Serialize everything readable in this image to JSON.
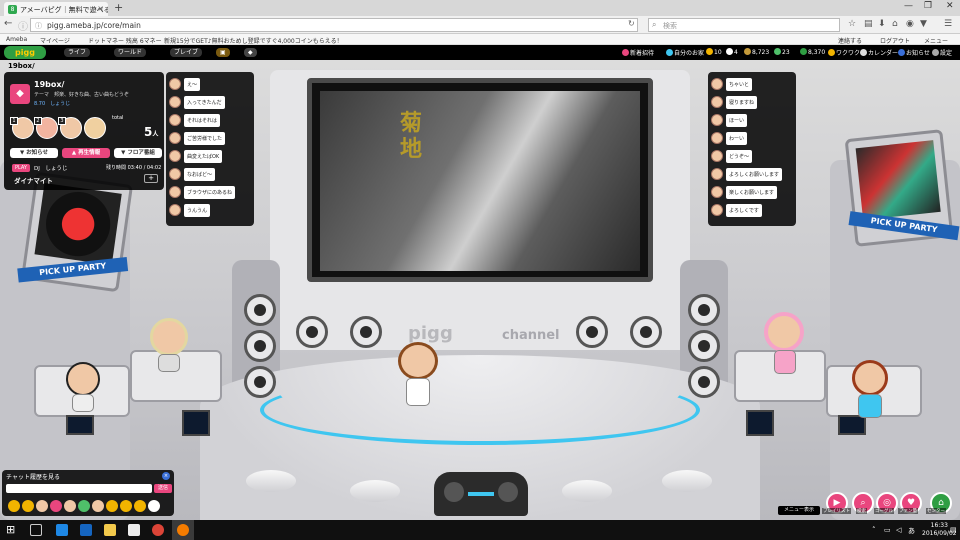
{
  "browser": {
    "tab_title": "アメーバピグ｜無料で遊べる…",
    "tab_close": "×",
    "new_tab": "+",
    "url": "pigg.ameba.jp/core/main",
    "search_placeholder": "検索"
  },
  "bookmarks": [
    {
      "label": "Ameba"
    },
    {
      "label": "マイページ"
    },
    {
      "label": "ドットマネー 残高 6マネー"
    },
    {
      "label": "新規15分でGET♪無料おためし登録ですぐ4,000コインもらえる！"
    },
    {
      "label": "連絡する"
    },
    {
      "label": "ログアウト"
    },
    {
      "label": "メニュー"
    }
  ],
  "ameba_bar": {
    "logo": "pigg",
    "menus": [
      "ライフ",
      "ワールド",
      "ブレイブ"
    ],
    "right_items": [
      {
        "label": "新着招待"
      },
      {
        "label": "自分のお家"
      },
      {
        "label": "10"
      },
      {
        "label": "4"
      },
      {
        "label": "8,723"
      },
      {
        "label": "23"
      },
      {
        "label": "8,370"
      },
      {
        "label": "ワクワク"
      },
      {
        "label": "カレンダー"
      },
      {
        "label": "お知らせ"
      },
      {
        "label": "設定"
      }
    ]
  },
  "room": {
    "breadcrumb": "19box/",
    "name": "19box/",
    "theme": "テーマ　邦楽、好きな曲、古い曲もどうぞ",
    "host": "8.70　しょうじ",
    "total_label": "total",
    "total_count": "5",
    "total_unit": "人",
    "people_numbers": [
      "1",
      "2",
      "3"
    ],
    "buttons": [
      "▼ お知らせ",
      "▲ 再生情報",
      "▼ フロア番組"
    ],
    "play_label": "PLAY",
    "dj": "DJ　しょうじ",
    "play_time": "残り時間 03:40 / 04:02",
    "song": "ダイナマイト",
    "add": "+"
  },
  "stage": {
    "pigg_logo": "pigg",
    "channel_logo": "channel",
    "pickup_left": "PICK UP PARTY",
    "pickup_right": "PICK UP PARTY",
    "video_text": "菊地"
  },
  "chat_left": [
    {
      "text": "え～"
    },
    {
      "text": "入ってきたんだ"
    },
    {
      "text": "それはそれは"
    },
    {
      "text": "ご苦労様でした"
    },
    {
      "text": "曲変えたばOK"
    },
    {
      "text": "なおばど～"
    },
    {
      "text": "ブラウザにのあるね"
    },
    {
      "text": "うんうん"
    }
  ],
  "chat_right": [
    {
      "text": "ちゃいと"
    },
    {
      "text": "寝りますね"
    },
    {
      "text": "ほーい"
    },
    {
      "text": "わーい"
    },
    {
      "text": "どうぞ～"
    },
    {
      "text": "よろしくお願いします"
    },
    {
      "text": "楽しくお願いします"
    },
    {
      "text": "よろしくです"
    }
  ],
  "chat_panel": {
    "label": "チャット履歴を見る",
    "close": "×",
    "send": "送信"
  },
  "right_buttons": [
    {
      "label": "プレイリスト",
      "color": "#e9467e"
    },
    {
      "label": "検索",
      "color": "#e9467e"
    },
    {
      "label": "ゴーグル",
      "color": "#e9467e"
    },
    {
      "label": "ファン量",
      "color": "#e9467e"
    },
    {
      "label": "センター",
      "color": "#2f9e43"
    }
  ],
  "menu_button": "メニュー表示",
  "taskbar": {
    "time": "16:33",
    "date": "2016/09/02",
    "ime": "あ"
  },
  "colors": {
    "accent": "#e9467e",
    "ameba_green": "#2f9e43",
    "cyan": "#3fc6f0"
  }
}
